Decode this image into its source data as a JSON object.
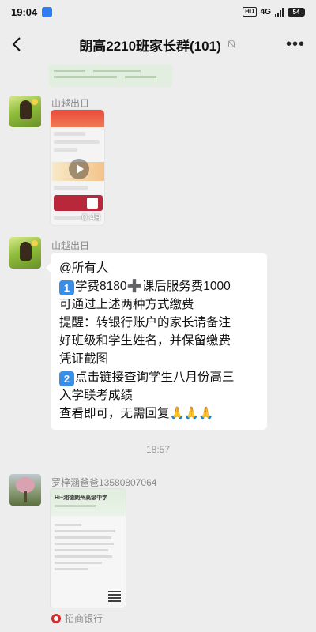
{
  "status_bar": {
    "time": "19:04",
    "network": "4G",
    "battery": "54"
  },
  "header": {
    "title": "朗高2210班家长群(101)"
  },
  "messages": [
    {
      "sender": "山越出日",
      "type": "video",
      "duration": "0:49"
    },
    {
      "sender": "山越出日",
      "type": "text",
      "lines": {
        "l1": "@所有人",
        "l2_num": "1",
        "l2_a": "学费8180",
        "l2_plus": "➕",
        "l2_b": "课后服务费1000",
        "l3": "可通过上述两种方式缴费",
        "l4": "提醒：转银行账户的家长请备注",
        "l5": "好班级和学生姓名，并保留缴费",
        "l6": "凭证截图",
        "l7_num": "2",
        "l7_text": "点击链接查询学生八月份高三",
        "l8": "入学联考成绩",
        "l9_text": "查看即可，无需回复",
        "l9_emoji": "🙏🙏🙏"
      }
    }
  ],
  "timestamp": "18:57",
  "receipt_message": {
    "sender": "罗梓涵爸爸13580807064",
    "card_school": "Hi~湘德朗州高级中学",
    "source_app": "招商银行"
  }
}
